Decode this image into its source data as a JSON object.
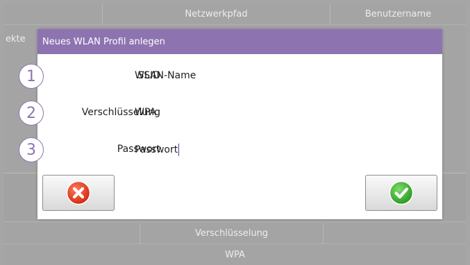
{
  "background": {
    "header_cols": [
      "Netzwerkpfad",
      "Benutzername"
    ],
    "side_fragment": "ekte",
    "header2_col": "Verschlüsselung",
    "row_value": "WPA"
  },
  "dialog": {
    "title": "Neues WLAN Profil anlegen",
    "fields": [
      {
        "number": "1",
        "label": "SSID",
        "value": "WLAN-Name"
      },
      {
        "number": "2",
        "label": "Verschlüsselung",
        "value": "WPA"
      },
      {
        "number": "3",
        "label": "Passwort",
        "value": "Passwort"
      }
    ],
    "cancel_icon": "red-x-icon",
    "ok_icon": "green-check-icon"
  },
  "colors": {
    "accent": "#8e73b1",
    "cancel": "#e8432a",
    "ok": "#3aa832"
  }
}
